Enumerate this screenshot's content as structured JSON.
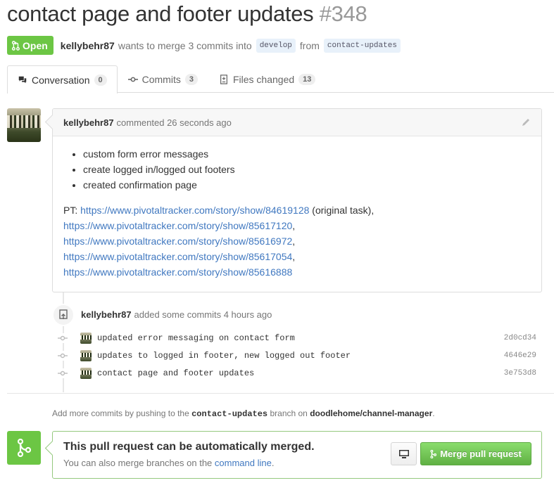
{
  "pr": {
    "title": "contact page and footer updates",
    "number": "#348",
    "state": "Open",
    "author": "kellybehr87",
    "merge_text": "wants to merge 3 commits into",
    "base_branch": "develop",
    "from_text": "from",
    "head_branch": "contact-updates"
  },
  "tabs": [
    {
      "label": "Conversation",
      "count": "0",
      "icon": "comment-discussion-icon"
    },
    {
      "label": "Commits",
      "count": "3",
      "icon": "git-commit-icon"
    },
    {
      "label": "Files changed",
      "count": "13",
      "icon": "diff-icon"
    }
  ],
  "comment": {
    "author": "kellybehr87",
    "meta": "commented 26 seconds ago",
    "items": [
      "custom form error messages",
      "create logged in/logged out footers",
      "created confirmation page"
    ],
    "pt_prefix": "PT:",
    "links": [
      "https://www.pivotaltracker.com/story/show/84619128",
      "https://www.pivotaltracker.com/story/show/85617120",
      "https://www.pivotaltracker.com/story/show/85616972",
      "https://www.pivotaltracker.com/story/show/85617054",
      "https://www.pivotaltracker.com/story/show/85616888"
    ],
    "link_suffixes": [
      " (original task),",
      ",",
      ",",
      ",",
      ""
    ]
  },
  "commits_event": {
    "author": "kellybehr87",
    "text": "added some commits 4 hours ago",
    "commits": [
      {
        "message": "updated error messaging on contact form",
        "sha": "2d0cd34"
      },
      {
        "message": "updates to logged in footer, new logged out footer",
        "sha": "4646e29"
      },
      {
        "message": "contact page and footer updates",
        "sha": "3e753d8"
      }
    ]
  },
  "help": {
    "prefix": "Add more commits by pushing to the",
    "branch": "contact-updates",
    "middle": "branch on",
    "repo": "doodlehome/channel-manager",
    "suffix": "."
  },
  "merge": {
    "title": "This pull request can be automatically merged.",
    "sub_prefix": "You can also merge branches on the",
    "sub_link": "command line",
    "sub_suffix": ".",
    "button": "Merge pull request"
  },
  "colors": {
    "accent_green": "#6cc644",
    "link_blue": "#4078c0"
  }
}
